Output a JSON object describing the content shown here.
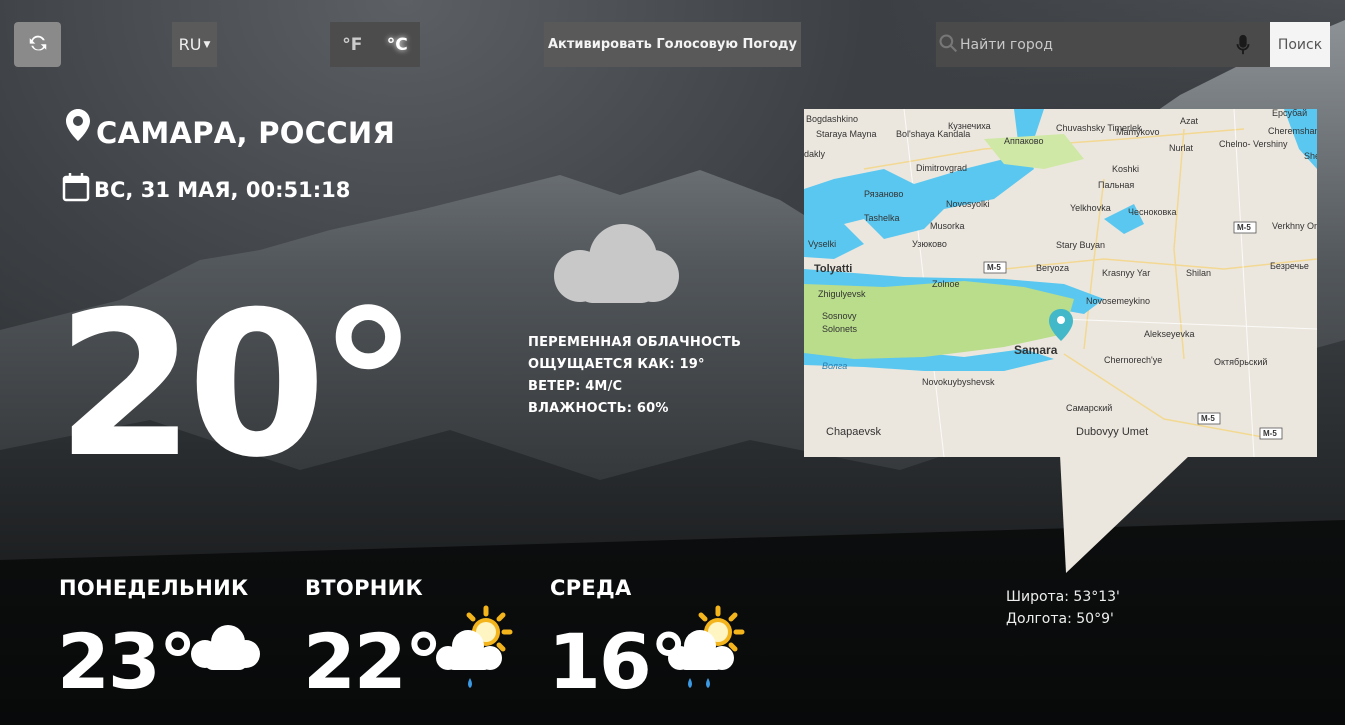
{
  "toolbar": {
    "language": "RU",
    "unit_f": "°F",
    "unit_c": "°C",
    "voice_button": "Активировать Голосовую Погоду",
    "search_placeholder": "Найти город",
    "search_button": "Поиск"
  },
  "current": {
    "location": "САМАРА, РОССИЯ",
    "datetime": "ВС, 31 МАЯ, 00:51:18",
    "temperature": "20°",
    "condition": "ПЕРЕМЕННАЯ ОБЛАЧНОСТЬ",
    "feels_like": "ОЩУЩАЕТСЯ КАК: 19°",
    "wind": "ВЕТЕР: 4М/С",
    "humidity": "ВЛАЖНОСТЬ: 60%",
    "icon": "cloud-icon"
  },
  "map": {
    "labels": {
      "samara": "Samara",
      "tolyatti": "Tolyatti",
      "chapaevsk": "Chapaevsk",
      "novokuybyshevsk": "Novokuybyshevsk",
      "zhigulyevsk": "Zhigulyevsk",
      "sosnovy": "Sosnovy",
      "solonets": "Solonets",
      "volga": "Волга",
      "dimitrovgrad": "Dimitrovgrad",
      "novosyolki": "Novosyolki",
      "musorka": "Musorka",
      "tashelka": "Tashelka",
      "vyselki": "Vyselki",
      "uzyukovo": "Узюково",
      "ryazanovo": "Рязаново",
      "zolnoe": "Zolnoe",
      "beryoza": "Beryoza",
      "krasny_yar": "Krasnyy Yar",
      "shilan": "Shilan",
      "novosemeykino": "Novosemeykino",
      "alekseyevka": "Alekseyevka",
      "chernorechye": "Chernorech'ye",
      "oktyabrsky": "Октябрьский",
      "samarsky": "Самарский",
      "dubovyy_umet": "Dubovyy Umet",
      "stary_buyan": "Stary Buyan",
      "yelkhovka": "Yelkhovka",
      "chesnokovka": "Чесноковка",
      "palnaya": "Пальная",
      "koshki": "Koshki",
      "nurlat": "Nurlat",
      "chelno_vershiny": "Chelno-\nVershiny",
      "mamykovo": "Mamykovo",
      "chuvashsky_timerlek": "Chuvashsky\nTimerlek",
      "appakovo": "Аппаково",
      "kuznechikha": "Кузнечиха",
      "bolshaya_kandala": "Bol'shaya\nKandala",
      "staraya_mayna": "Staraya Mayna",
      "bogdashkino": "Bogdashkino",
      "verkhny_orlyanka": "Verkhny\nOrlyank",
      "bezrechye": "Безречье",
      "cheremshan": "Cheremshan",
      "azat": "Azat",
      "yersubay": "Ерсубай",
      "she": "She",
      "shi": "Sh",
      "dakly": "dakly",
      "m5": "М-5"
    }
  },
  "coords": {
    "latitude": "Широта: 53°13'",
    "longitude": "Долгота: 50°9'"
  },
  "forecast": [
    {
      "day": "ПОНЕДЕЛЬНИК",
      "temp": "23°",
      "icon": "cloud-icon"
    },
    {
      "day": "ВТОРНИК",
      "temp": "22°",
      "icon": "sun-cloud-rain-icon"
    },
    {
      "day": "СРЕДА",
      "temp": "16°",
      "icon": "sun-cloud-rain-icon"
    }
  ],
  "colors": {
    "accent": "#ffffff",
    "map_water": "#5ac7f0",
    "map_land": "#ece7de",
    "map_park": "#b9dd8a",
    "sun": "#f4b41c"
  }
}
